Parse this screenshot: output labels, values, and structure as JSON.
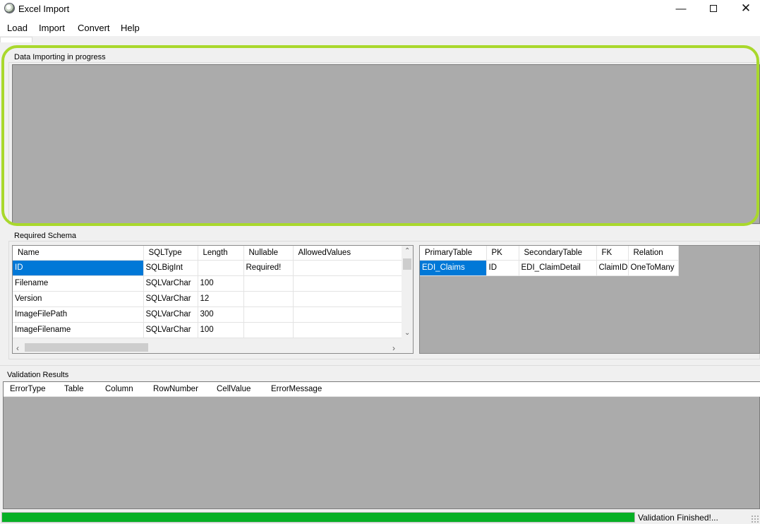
{
  "window": {
    "title": "Excel Import"
  },
  "menu": [
    "Load",
    "Import",
    "Convert",
    "Help"
  ],
  "import_group": {
    "legend": "Data Importing in progress"
  },
  "schema_group": {
    "legend": "Required Schema",
    "columns": [
      "Name",
      "SQLType",
      "Length",
      "Nullable",
      "AllowedValues"
    ],
    "rows": [
      [
        "ID",
        "SQLBigInt",
        "",
        "Required!",
        ""
      ],
      [
        "Filename",
        "SQLVarChar",
        "100",
        "",
        ""
      ],
      [
        "Version",
        "SQLVarChar",
        "12",
        "",
        ""
      ],
      [
        "ImageFilePath",
        "SQLVarChar",
        "300",
        "",
        ""
      ],
      [
        "ImageFilename",
        "SQLVarChar",
        "100",
        "",
        ""
      ]
    ]
  },
  "relations": {
    "columns": [
      "PrimaryTable",
      "PK",
      "SecondaryTable",
      "FK",
      "Relation"
    ],
    "rows": [
      [
        "EDI_Claims",
        "ID",
        "EDI_ClaimDetail",
        "ClaimID",
        "OneToMany"
      ]
    ]
  },
  "validation": {
    "legend": "Validation Results",
    "columns": [
      "ErrorType",
      "Table",
      "Column",
      "RowNumber",
      "CellValue",
      "ErrorMessage"
    ]
  },
  "status": {
    "text": "Validation Finished!...",
    "progress": 1.0,
    "progress_color": "#06b025"
  },
  "colors": {
    "highlight": "#a9d82c",
    "selection": "#0078d7",
    "grid_bg": "#ababab"
  }
}
